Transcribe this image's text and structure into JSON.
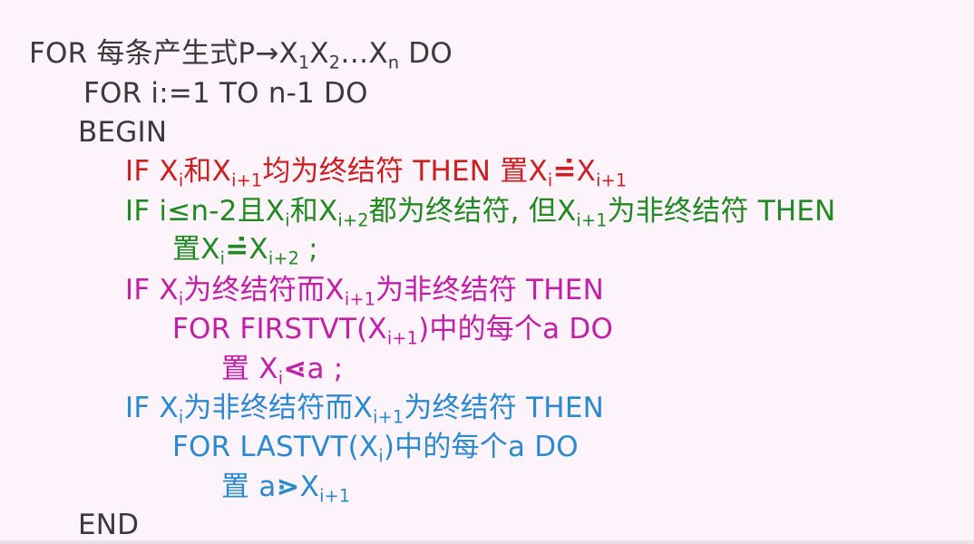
{
  "lines": {
    "l1": {
      "a": "FOR  每条产生式P→X",
      "s1": "1",
      "b": "X",
      "s2": "2",
      "c": "…X",
      "s3": "n",
      "d": "  DO"
    },
    "l2": {
      "a": "FOR  i:=1  TO  n-1 DO"
    },
    "l3": {
      "a": "BEGIN"
    },
    "l4": {
      "a": "IF  X",
      "s1": "i",
      "b": "和X",
      "s2": "i+1",
      "c": "均为终结符  THEN  置X",
      "s3": "i",
      "op": "=̇",
      "d": "X",
      "s4": "i+1"
    },
    "l5": {
      "a": "IF  i≤n-2且X",
      "s1": "i",
      "b": "和X",
      "s2": "i+2",
      "c": "都为终结符, 但X",
      "s3": "i+1",
      "d": "为非终结符  THEN"
    },
    "l6": {
      "a": "置X",
      "s1": "i",
      "op": "=̇",
      "b": "X",
      "s2": "i+2",
      "c": " ;"
    },
    "l7": {
      "a": "IF  X",
      "s1": "i",
      "b": "为终结符而X",
      "s2": "i+1",
      "c": "为非终结符  THEN"
    },
    "l8": {
      "a": "FOR  FIRSTVT(X",
      "s1": "i+1",
      "b": ")中的每个a  DO"
    },
    "l9": {
      "a": "置 X",
      "s1": "i",
      "op": "⋖",
      "b": "a ;"
    },
    "l10": {
      "a": "IF  X",
      "s1": "i",
      "b": "为非终结符而X",
      "s2": "i+1",
      "c": "为终结符  THEN"
    },
    "l11": {
      "a": "FOR  LASTVT(X",
      "s1": "i",
      "b": ")中的每个a   DO"
    },
    "l12": {
      "a": "置  a",
      "op": "⋗",
      "b": "X",
      "s1": "i+1"
    },
    "l13": {
      "a": "END"
    }
  },
  "colors": {
    "text": "#3a3a3a",
    "red": "#cc1f1f",
    "green": "#1f8a1f",
    "magenta": "#c21fa8",
    "blue": "#2a8ad0",
    "background": "#fcf3fb"
  }
}
